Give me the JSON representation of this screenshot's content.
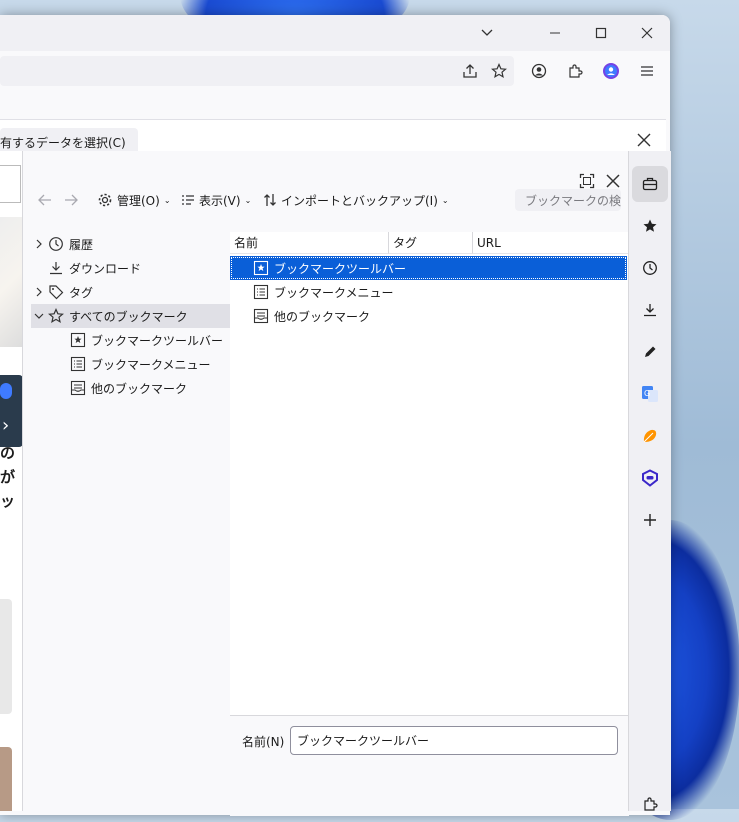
{
  "infobar": {
    "button_label": "有するデータを選択(C)"
  },
  "library": {
    "toolbar": {
      "organize": "管理(O)",
      "views": "表示(V)",
      "import_backup": "インポートとバックアップ(I)",
      "search_placeholder": "ブックマークの検索"
    },
    "tree": [
      {
        "label": "履歴",
        "icon": "clock-icon"
      },
      {
        "label": "ダウンロード",
        "icon": "download-icon"
      },
      {
        "label": "タグ",
        "icon": "tag-icon"
      },
      {
        "label": "すべてのブックマーク",
        "icon": "star-outline-icon"
      },
      {
        "label": "ブックマークツールバー",
        "icon": "bookmark-toolbar-icon"
      },
      {
        "label": "ブックマークメニュー",
        "icon": "bookmark-menu-icon"
      },
      {
        "label": "他のブックマーク",
        "icon": "unsorted-bookmarks-icon"
      }
    ],
    "columns": {
      "name": "名前",
      "tags": "タグ",
      "url": "URL"
    },
    "items": [
      {
        "label": "ブックマークツールバー"
      },
      {
        "label": "ブックマークメニュー"
      },
      {
        "label": "他のブックマーク"
      }
    ],
    "details": {
      "name_label": "名前(N)",
      "name_value": "ブックマークツールバー"
    }
  },
  "page_fragment": {
    "line1": "の",
    "line2": "が",
    "line3": "ッ"
  },
  "colors": {
    "selection": "#0a5fd8",
    "accent_profile": "#7542e5"
  }
}
